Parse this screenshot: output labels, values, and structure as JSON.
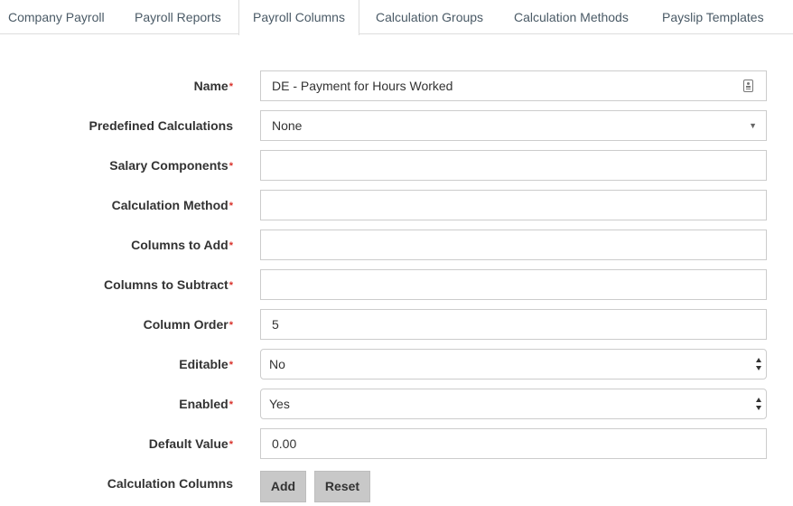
{
  "tabs": [
    {
      "label": "Company Payroll",
      "active": false
    },
    {
      "label": "Payroll Reports",
      "active": false
    },
    {
      "label": "Payroll Columns",
      "active": true
    },
    {
      "label": "Calculation Groups",
      "active": false
    },
    {
      "label": "Calculation Methods",
      "active": false
    },
    {
      "label": "Payslip Templates",
      "active": false
    }
  ],
  "required_marker": "*",
  "form": {
    "name": {
      "label": "Name",
      "required": true,
      "value": "DE - Payment for Hours Worked",
      "icon": "contact-card-icon"
    },
    "predefined_calculations": {
      "label": "Predefined Calculations",
      "required": false,
      "value": "None",
      "icon": "caret-down-icon"
    },
    "salary_components": {
      "label": "Salary Components",
      "required": true,
      "value": ""
    },
    "calculation_method": {
      "label": "Calculation Method",
      "required": true,
      "value": ""
    },
    "columns_to_add": {
      "label": "Columns to Add",
      "required": true,
      "value": ""
    },
    "columns_to_subtract": {
      "label": "Columns to Subtract",
      "required": true,
      "value": ""
    },
    "column_order": {
      "label": "Column Order",
      "required": true,
      "value": "5"
    },
    "editable": {
      "label": "Editable",
      "required": true,
      "value": "No",
      "icon": "updown-arrows-icon"
    },
    "enabled": {
      "label": "Enabled",
      "required": true,
      "value": "Yes",
      "icon": "updown-arrows-icon"
    },
    "default_value": {
      "label": "Default Value",
      "required": true,
      "value": "0.00"
    },
    "calculation_columns": {
      "label": "Calculation Columns",
      "required": false
    }
  },
  "buttons": {
    "add": "Add",
    "reset": "Reset"
  },
  "colors": {
    "tab_text": "#4a5a66",
    "required": "#d9322b",
    "button_bg": "#c8c8c8",
    "border": "#cccccc"
  }
}
